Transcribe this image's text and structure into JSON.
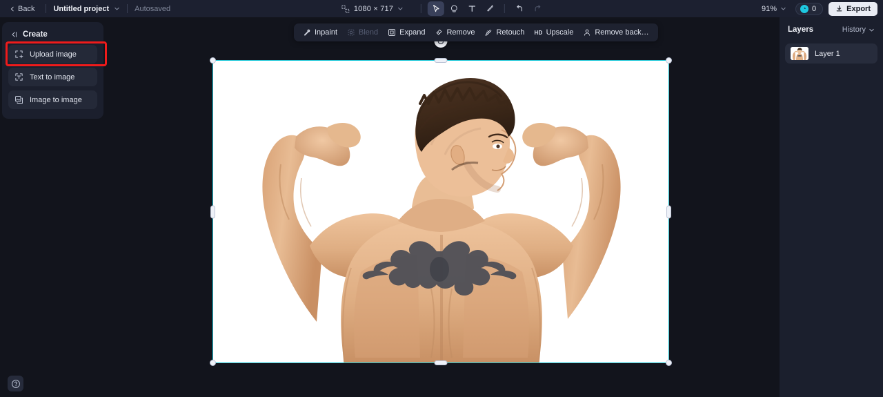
{
  "topbar": {
    "back_label": "Back",
    "project_name": "Untitled project",
    "autosave_label": "Autosaved",
    "canvas_size": "1080 × 717",
    "zoom_level": "91%",
    "credits_count": "0",
    "export_label": "Export",
    "tools": [
      {
        "name": "select-tool",
        "glyph": "cursor",
        "active": true
      },
      {
        "name": "shape-tool",
        "glyph": "blob",
        "active": false
      },
      {
        "name": "text-tool",
        "glyph": "T",
        "active": false
      },
      {
        "name": "brush-tool",
        "glyph": "brush",
        "active": false
      },
      {
        "name": "undo-button",
        "glyph": "undo",
        "active": false
      },
      {
        "name": "redo-button",
        "glyph": "redo",
        "active": false
      }
    ]
  },
  "left_panel": {
    "title": "Create",
    "items": [
      {
        "label": "Upload image",
        "icon": "upload-image-icon",
        "highlighted": true
      },
      {
        "label": "Text to image",
        "icon": "text-to-image-icon",
        "highlighted": false
      },
      {
        "label": "Image to image",
        "icon": "image-to-image-icon",
        "highlighted": false
      }
    ]
  },
  "float_toolbar": {
    "items": [
      {
        "label": "Inpaint",
        "icon": "magic-wand-icon",
        "disabled": false
      },
      {
        "label": "Blend",
        "icon": "blend-icon",
        "disabled": true
      },
      {
        "label": "Expand",
        "icon": "expand-icon",
        "disabled": false
      },
      {
        "label": "Remove",
        "icon": "eraser-icon",
        "disabled": false
      },
      {
        "label": "Retouch",
        "icon": "retouch-icon",
        "disabled": false
      },
      {
        "label": "Upscale",
        "icon": "hd-icon",
        "badge": "HD",
        "disabled": false
      },
      {
        "label": "Remove back…",
        "icon": "remove-background-icon",
        "disabled": false
      }
    ]
  },
  "right_panel": {
    "title": "Layers",
    "history_label": "History",
    "layers": [
      {
        "name": "Layer 1"
      }
    ]
  },
  "canvas": {
    "subject": "muscular man flexing both biceps, viewed from behind, tribal tattoo on upper back, white background",
    "background": "#ffffff"
  },
  "help": {
    "label": "?"
  },
  "colors": {
    "accent": "#1ec8d8",
    "highlight_box": "#ef1b1b",
    "panel_bg": "#1b1f2d",
    "app_bg": "#12141c",
    "topbar_bg": "#1c2030"
  }
}
